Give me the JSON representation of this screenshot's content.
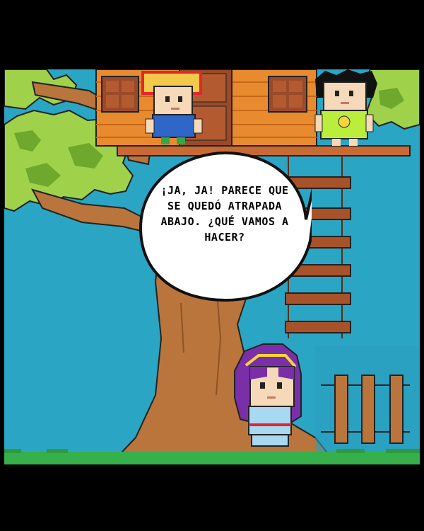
{
  "panel": {
    "speech_bubble": {
      "speaker": "right-boy",
      "text": "¡Ja, ja! Parece que se quedó atrapada abajo. ¿Qué vamos a hacer?"
    }
  },
  "characters": [
    {
      "name": "left-boy",
      "hair": "#f2c94a",
      "outline": "#e2262b",
      "shirt": "#2e67c8"
    },
    {
      "name": "right-boy",
      "hair": "#111111",
      "shirt": "#b9ee3c"
    },
    {
      "name": "purple-haired-girl",
      "hair": "#7a2fa8",
      "headband": "#f2d63a",
      "dress": "#a9d8f2"
    }
  ],
  "colors": {
    "sky": "#2aa6c4",
    "leaves": "#9fd24a",
    "leaves_dark": "#6ea82c",
    "trunk": "#b9753c",
    "house": "#e88a2e",
    "ladder": "#a8522a",
    "grass": "#35b04a"
  }
}
